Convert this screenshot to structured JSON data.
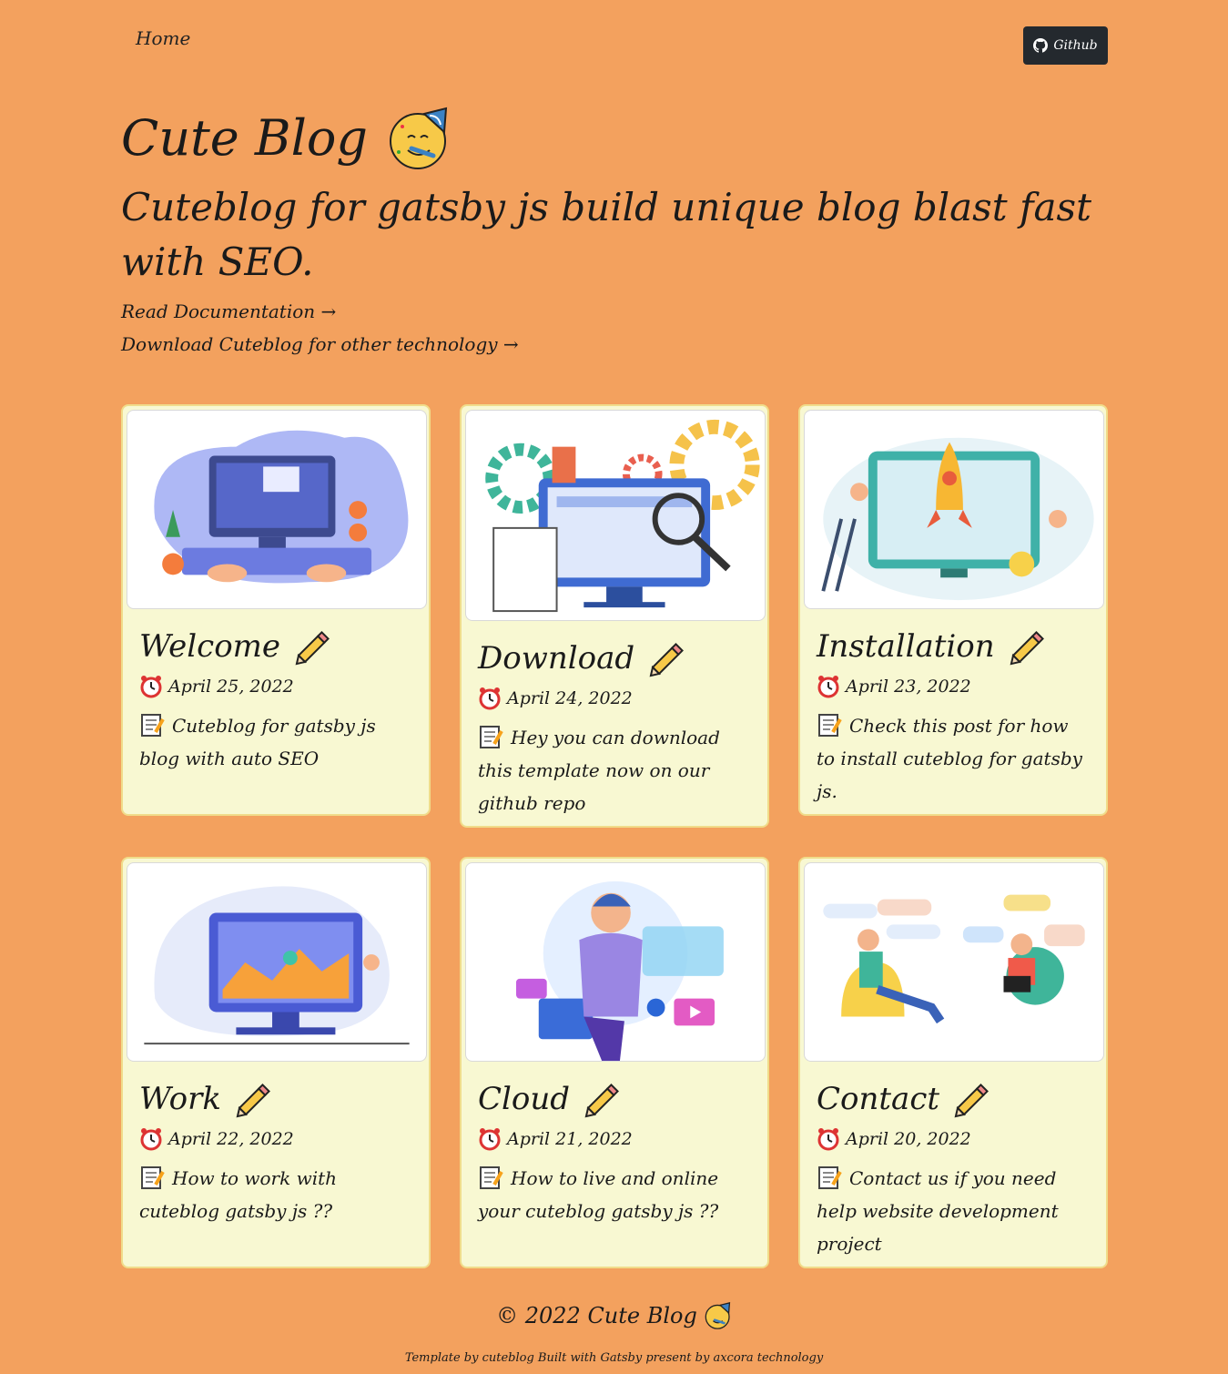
{
  "nav": {
    "home_label": "Home",
    "github_label": "Github"
  },
  "hero": {
    "title": "Cute Blog",
    "tagline": "Cuteblog for gatsby js build unique blog blast fast with SEO.",
    "links": [
      "Read Documentation →",
      "Download Cuteblog for other technology →"
    ]
  },
  "posts": [
    {
      "title": "Welcome",
      "date": "April 25, 2022",
      "description": "Cuteblog for gatsby js blog with auto SEO",
      "image_icon": "typing-desk-illustration"
    },
    {
      "title": "Download",
      "date": "April 24, 2022",
      "description": "Hey you can download this template now on our github repo",
      "image_icon": "testing-monitor-illustration"
    },
    {
      "title": "Installation",
      "date": "April 23, 2022",
      "description": "Check this post for how to install cuteblog for gatsby js.",
      "image_icon": "rocket-launch-illustration"
    },
    {
      "title": "Work",
      "date": "April 22, 2022",
      "description": "How to work with cuteblog gatsby js ??",
      "image_icon": "analytics-monitor-illustration"
    },
    {
      "title": "Cloud",
      "date": "April 21, 2022",
      "description": "How to live and online your cuteblog gatsby js ??",
      "image_icon": "designer-illustration"
    },
    {
      "title": "Contact",
      "date": "April 20, 2022",
      "description": "Contact us if you need help website development project",
      "image_icon": "chat-people-illustration"
    }
  ],
  "footer": {
    "copyright": "© 2022 Cute Blog",
    "credit": "Template by cuteblog Built with Gatsby present by axcora technology"
  },
  "colors": {
    "background": "#f3a15e",
    "card": "#f8f8d2",
    "card_border": "#f0dc8a",
    "button": "#24292e"
  }
}
